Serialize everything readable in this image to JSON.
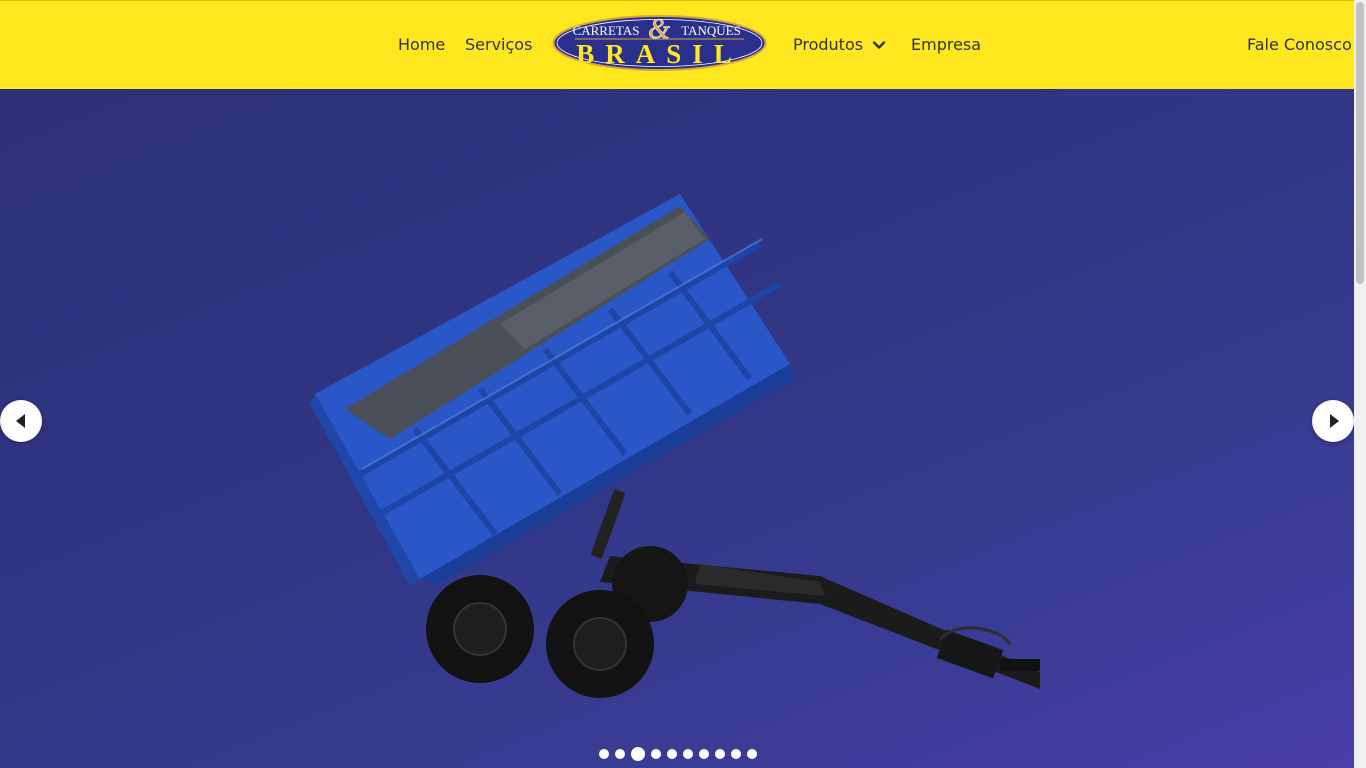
{
  "nav": {
    "home": "Home",
    "servicos": "Serviços",
    "produtos": "Produtos",
    "empresa": "Empresa",
    "fale_conosco": "Fale Conosco"
  },
  "logo": {
    "top_left": "CARRETAS",
    "amp": "&",
    "top_right": "TANQUES",
    "main": "BRASIL"
  },
  "colors": {
    "header_bg": "#ffe81f",
    "hero_bg": "#2f3580",
    "logo_blue": "#2a2f8c",
    "logo_gold": "#d9a53a"
  },
  "icons": {
    "produtos_dropdown": "chevron-down-icon",
    "prev": "caret-left-icon",
    "next": "caret-right-icon"
  },
  "slider": {
    "total_slides": 10,
    "active_slide": 3
  }
}
